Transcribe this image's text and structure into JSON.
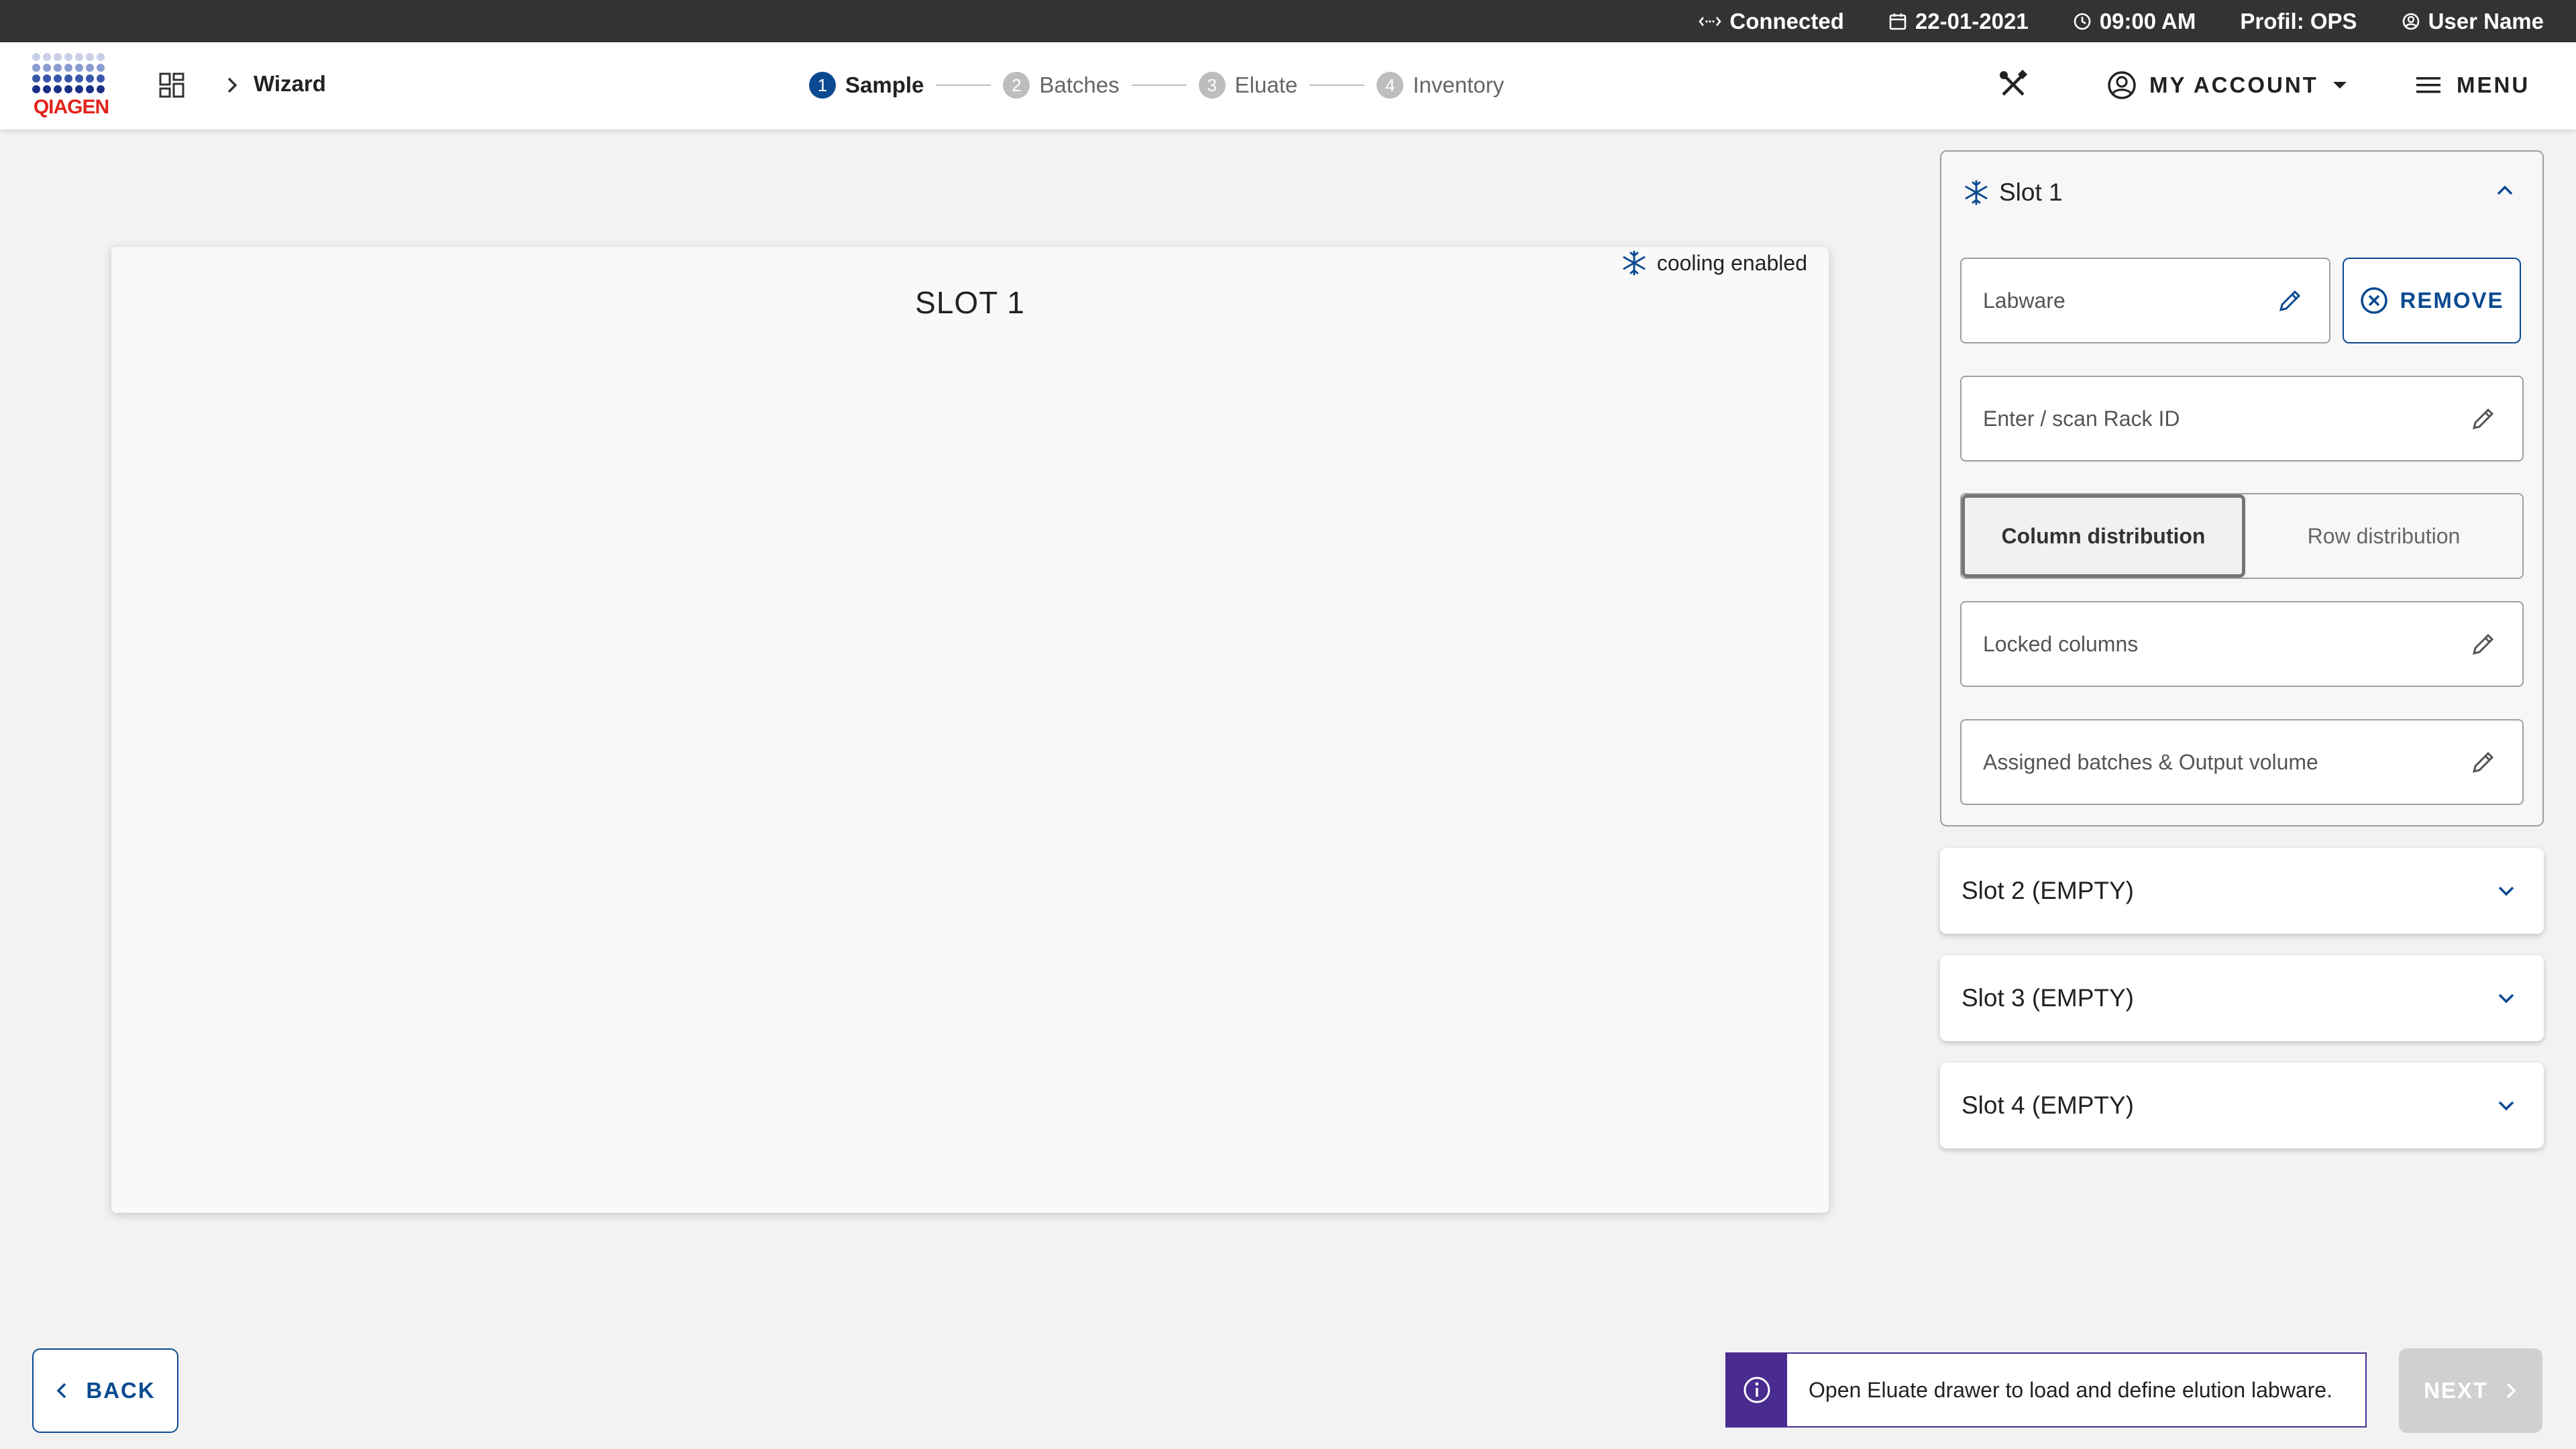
{
  "status_bar": {
    "connection": "Connected",
    "date": "22-01-2021",
    "time": "09:00 AM",
    "profile": "Profil: OPS",
    "user": "User Name"
  },
  "header": {
    "logo_text": "QIAGEN",
    "breadcrumb": "Wizard",
    "steps": [
      {
        "num": "1",
        "label": "Sample",
        "active": true
      },
      {
        "num": "2",
        "label": "Batches",
        "active": false
      },
      {
        "num": "3",
        "label": "Eluate",
        "active": false
      },
      {
        "num": "4",
        "label": "Inventory",
        "active": false
      }
    ],
    "account_label": "MY ACCOUNT",
    "menu_label": "MENU"
  },
  "main": {
    "slot_title": "SLOT 1",
    "cooling_label": "cooling enabled"
  },
  "panel": {
    "title": "Slot 1",
    "labware_label": "Labware",
    "remove_label": "REMOVE",
    "rack_id_placeholder": "Enter / scan Rack ID",
    "distribution_options": [
      "Column distribution",
      "Row distribution"
    ],
    "selected_distribution": "Column distribution",
    "locked_columns_label": "Locked columns",
    "assigned_batches_label": "Assigned batches & Output volume",
    "other_slots": [
      "Slot 2 (EMPTY)",
      "Slot 3 (EMPTY)",
      "Slot 4 (EMPTY)"
    ]
  },
  "footer": {
    "back_label": "BACK",
    "info_message": "Open Eluate drawer to load and define elution labware.",
    "next_label": "NEXT"
  },
  "colors": {
    "primary": "#0b4a91",
    "info": "#4a2c91",
    "status_bar": "#333333",
    "logo_red": "#e2231a",
    "disabled": "#d0d0d0"
  }
}
